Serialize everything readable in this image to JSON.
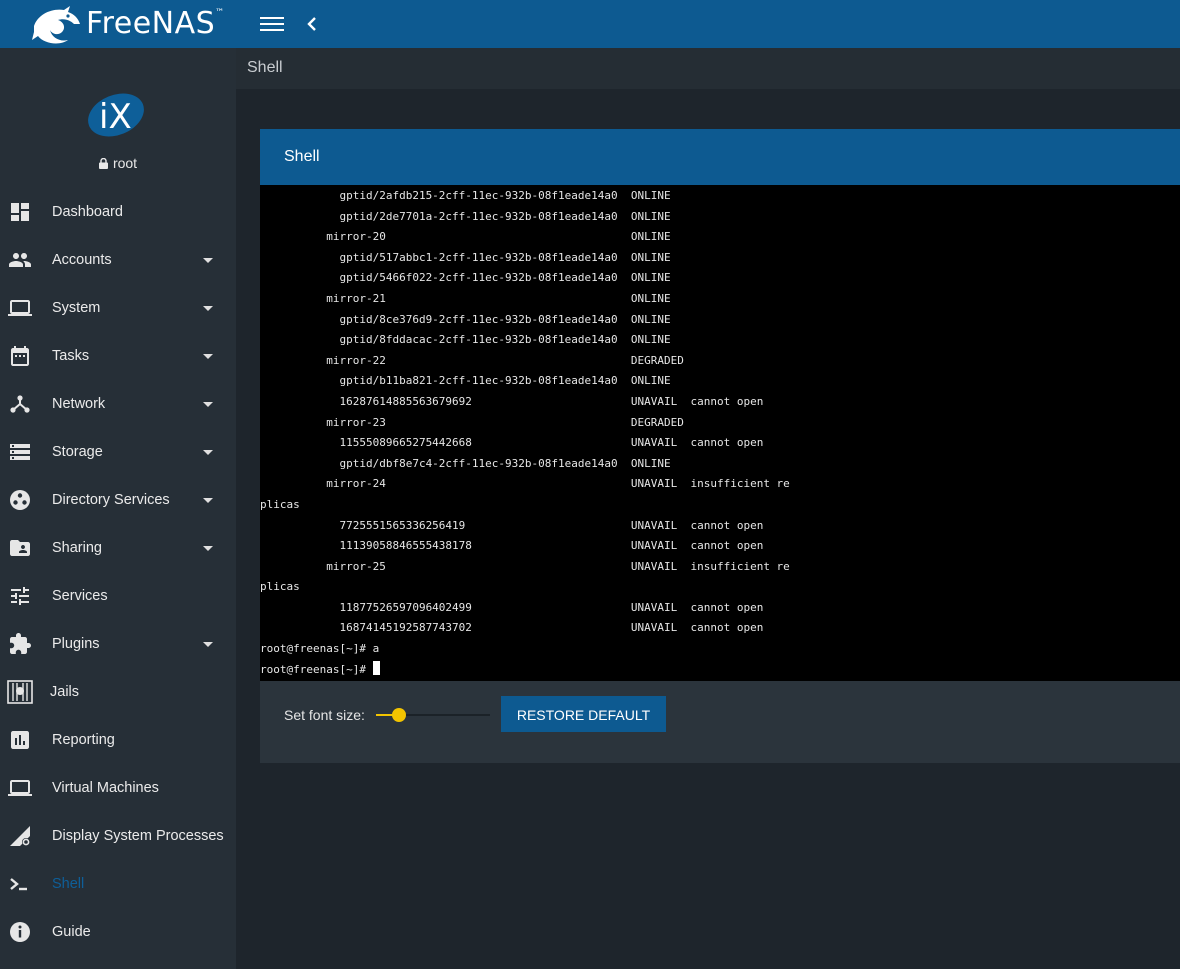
{
  "brand": {
    "name": "FreeNAS",
    "trademark": "™"
  },
  "sidebar": {
    "user": "root",
    "items": [
      {
        "label": "Dashboard",
        "icon": "dashboard-icon",
        "has_submenu": false
      },
      {
        "label": "Accounts",
        "icon": "people-icon",
        "has_submenu": true
      },
      {
        "label": "System",
        "icon": "laptop-icon",
        "has_submenu": true
      },
      {
        "label": "Tasks",
        "icon": "calendar-icon",
        "has_submenu": true
      },
      {
        "label": "Network",
        "icon": "network-icon",
        "has_submenu": true
      },
      {
        "label": "Storage",
        "icon": "storage-icon",
        "has_submenu": true
      },
      {
        "label": "Directory Services",
        "icon": "directory-icon",
        "has_submenu": true
      },
      {
        "label": "Sharing",
        "icon": "folder-shared-icon",
        "has_submenu": true
      },
      {
        "label": "Services",
        "icon": "tune-icon",
        "has_submenu": false
      },
      {
        "label": "Plugins",
        "icon": "puzzle-icon",
        "has_submenu": true
      },
      {
        "label": "Jails",
        "icon": "jail-icon",
        "has_submenu": false
      },
      {
        "label": "Reporting",
        "icon": "chart-icon",
        "has_submenu": false
      },
      {
        "label": "Virtual Machines",
        "icon": "computer-icon",
        "has_submenu": false
      },
      {
        "label": "Display System Processes",
        "icon": "processes-icon",
        "has_submenu": false
      },
      {
        "label": "Shell",
        "icon": "terminal-icon",
        "has_submenu": false,
        "active": true
      },
      {
        "label": "Guide",
        "icon": "info-icon",
        "has_submenu": false
      }
    ]
  },
  "page": {
    "breadcrumb": "Shell",
    "card_title": "Shell"
  },
  "terminal": {
    "lines": [
      "            gptid/2afdb215-2cff-11ec-932b-08f1eade14a0  ONLINE",
      "            gptid/2de7701a-2cff-11ec-932b-08f1eade14a0  ONLINE",
      "          mirror-20                                     ONLINE",
      "            gptid/517abbc1-2cff-11ec-932b-08f1eade14a0  ONLINE",
      "            gptid/5466f022-2cff-11ec-932b-08f1eade14a0  ONLINE",
      "          mirror-21                                     ONLINE",
      "            gptid/8ce376d9-2cff-11ec-932b-08f1eade14a0  ONLINE",
      "            gptid/8fddacac-2cff-11ec-932b-08f1eade14a0  ONLINE",
      "          mirror-22                                     DEGRADED",
      "            gptid/b11ba821-2cff-11ec-932b-08f1eade14a0  ONLINE",
      "            16287614885563679692                        UNAVAIL  cannot open",
      "          mirror-23                                     DEGRADED",
      "            11555089665275442668                        UNAVAIL  cannot open",
      "            gptid/dbf8e7c4-2cff-11ec-932b-08f1eade14a0  ONLINE",
      "          mirror-24                                     UNAVAIL  insufficient re",
      "plicas",
      "            7725551565336256419                         UNAVAIL  cannot open",
      "            11139058846555438178                        UNAVAIL  cannot open",
      "          mirror-25                                     UNAVAIL  insufficient re",
      "plicas",
      "            11877526597096402499                        UNAVAIL  cannot open",
      "            16874145192587743702                        UNAVAIL  cannot open",
      "root@freenas[~]# a",
      "root@freenas[~]# "
    ]
  },
  "controls": {
    "font_size_label": "Set font size:",
    "font_size_fraction": 0.2,
    "restore_label": "RESTORE DEFAULT"
  },
  "colors": {
    "primary": "#0d5a91",
    "accent": "#f3c400",
    "sidebar": "#262f37",
    "background": "#1e252c"
  }
}
